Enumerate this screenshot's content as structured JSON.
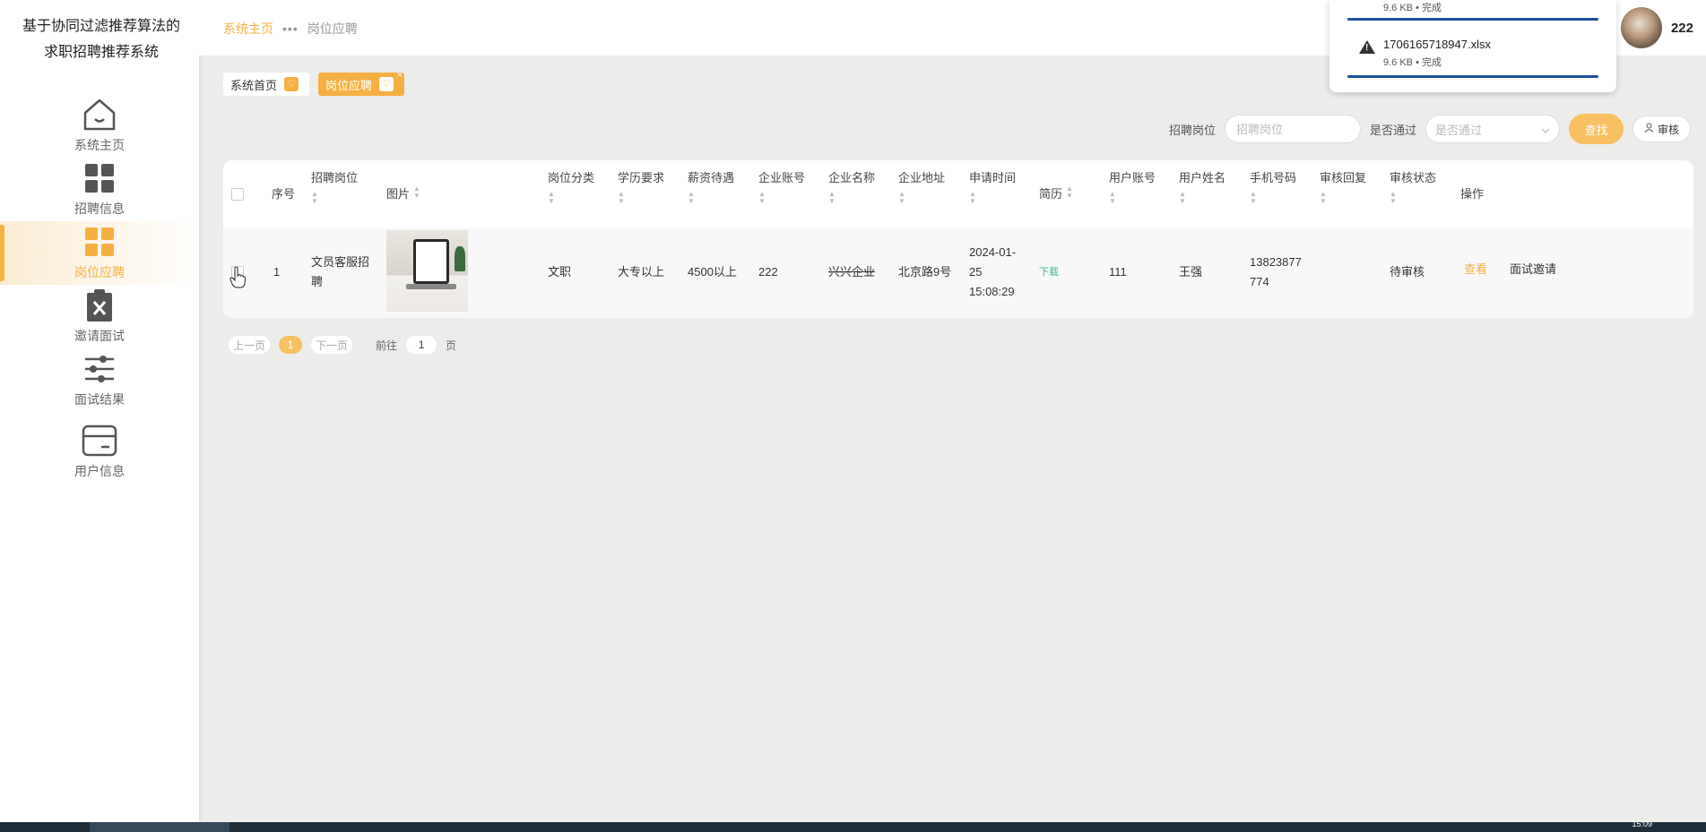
{
  "app": {
    "title_line1": "基于协同过滤推荐算法的",
    "title_line2": "求职招聘推荐系统"
  },
  "sidebar": {
    "items": [
      {
        "label": "系统主页",
        "icon": "home-icon"
      },
      {
        "label": "招聘信息",
        "icon": "grid-icon"
      },
      {
        "label": "岗位应聘",
        "icon": "grid-icon",
        "active": true
      },
      {
        "label": "邀请面试",
        "icon": "clipboard-x-icon"
      },
      {
        "label": "面试结果",
        "icon": "sliders-icon"
      },
      {
        "label": "用户信息",
        "icon": "card-icon"
      }
    ]
  },
  "header": {
    "breadcrumb_home": "系统主页",
    "breadcrumb_sep": "•••",
    "breadcrumb_current": "岗位应聘",
    "username": "222"
  },
  "download": {
    "item1_meta": "9.6 KB • 完成",
    "item2_name": "1706165718947.xlsx",
    "item2_meta": "9.6 KB • 完成"
  },
  "tabs": [
    {
      "label": "系统首页"
    },
    {
      "label": "岗位应聘",
      "close": "×"
    }
  ],
  "search": {
    "job_label": "招聘岗位",
    "job_placeholder": "招聘岗位",
    "pass_label": "是否通过",
    "pass_placeholder": "是否通过",
    "find_button": "查找",
    "audit_button": "审核"
  },
  "table": {
    "columns": [
      "序号",
      "招聘岗位",
      "图片",
      "岗位分类",
      "学历要求",
      "薪资待遇",
      "企业账号",
      "企业名称",
      "企业地址",
      "申请时间",
      "简历",
      "用户账号",
      "用户姓名",
      "手机号码",
      "审核回复",
      "审核状态",
      "操作"
    ],
    "rows": [
      {
        "index": "1",
        "job": "文员客服招聘",
        "category": "文职",
        "education": "大专以上",
        "salary": "4500以上",
        "company_account": "222",
        "company_name": "兴兴企业",
        "company_address": "北京路9号",
        "apply_time": "2024-01-25 15:08:29",
        "resume": "下载",
        "user_account": "111",
        "user_name": "王强",
        "phone": "13823877774",
        "audit_reply": "",
        "audit_status": "待审核",
        "action_view": "查看",
        "action_invite": "面试邀请"
      }
    ]
  },
  "pager": {
    "prev": "上一页",
    "page": "1",
    "next": "下一页",
    "goto_label": "前往",
    "goto_value": "1",
    "page_suffix": "页"
  },
  "taskbar": {
    "clock": "15:09"
  },
  "colors": {
    "accent": "#f5b041",
    "accent_light": "#f8c060",
    "green": "#3cba92",
    "progress_blue": "#1a4fa0"
  }
}
